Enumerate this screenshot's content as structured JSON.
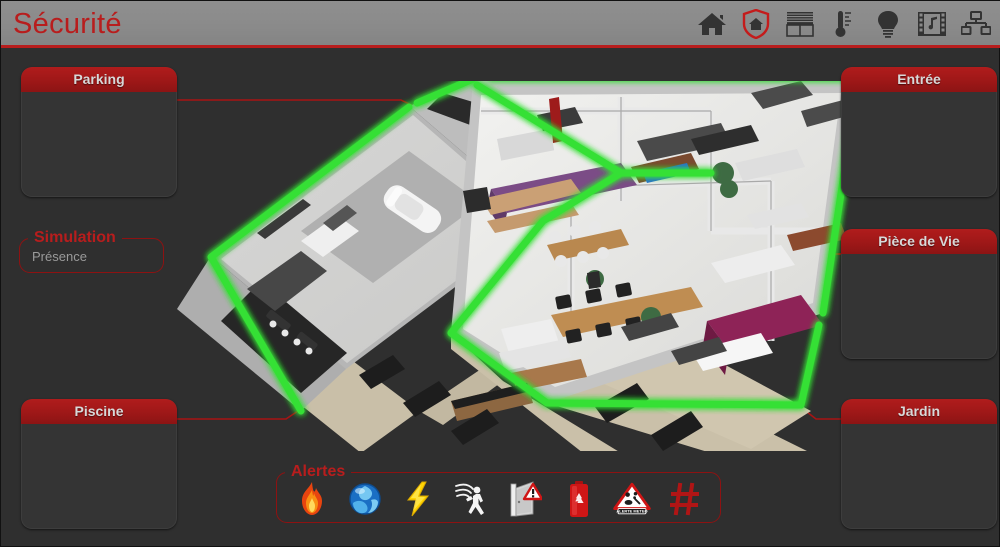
{
  "header": {
    "title": "Sécurité",
    "accent_color": "#b81d1d",
    "bar_color": "#8a8a8a",
    "toolbar": [
      {
        "name": "home-icon",
        "label": "Accueil",
        "active": false
      },
      {
        "name": "shield-home-icon",
        "label": "Sécurité",
        "active": true
      },
      {
        "name": "blinds-icon",
        "label": "Volets",
        "active": false
      },
      {
        "name": "thermometer-icon",
        "label": "Chauffage",
        "active": false
      },
      {
        "name": "lightbulb-icon",
        "label": "Éclairage",
        "active": false
      },
      {
        "name": "media-icon",
        "label": "Multimédia",
        "active": false
      },
      {
        "name": "network-icon",
        "label": "Réseau",
        "active": false
      }
    ]
  },
  "zones": {
    "parking": {
      "title": "Parking"
    },
    "piscine": {
      "title": "Piscine"
    },
    "entree": {
      "title": "Entrée"
    },
    "piece": {
      "title": "Pièce de Vie"
    },
    "jardin": {
      "title": "Jardin"
    }
  },
  "simulation": {
    "legend": "Simulation",
    "value": "Présence"
  },
  "alertes": {
    "legend": "Alertes",
    "icons": [
      {
        "name": "fire-alert-icon",
        "label": "Incendie"
      },
      {
        "name": "water-alert-icon",
        "label": "Fuite d'eau"
      },
      {
        "name": "power-alert-icon",
        "label": "Électricité"
      },
      {
        "name": "motion-alert-icon",
        "label": "Détection de mouvement"
      },
      {
        "name": "door-alert-icon",
        "label": "Ouverture de porte"
      },
      {
        "name": "battery-alert-icon",
        "label": "Batterie"
      },
      {
        "name": "weather-alert-icon",
        "label": "ALERTE METEO"
      },
      {
        "name": "grid-alert-icon",
        "label": "Réseau"
      }
    ],
    "weather_badge": "ALERTE METEO"
  },
  "floorplan": {
    "name": "floor-plan-3d",
    "perimeter_color": "#35e035",
    "marker_color": "#cc1111",
    "connector_color": "#a81414",
    "status": "armed"
  }
}
